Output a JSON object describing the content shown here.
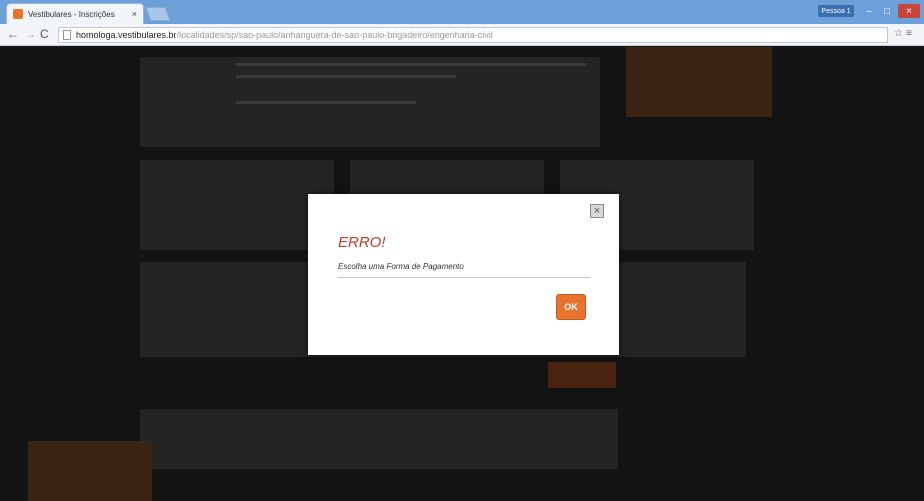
{
  "browser": {
    "tab_title": "Vestibulares - Inscrições",
    "tab_close": "×",
    "user_badge": "Pessoa 1",
    "win_min": "–",
    "win_max": "□",
    "win_close": "×",
    "url_host": "homologa.vestibulares.br",
    "url_path": "/localidades/sp/sao-paulo/anhanguera-de-sao-paulo-brigadeiro/engenharia-civil"
  },
  "dialog": {
    "title": "ERRO!",
    "message": "Escolha uma Forma de Pagamento",
    "ok_label": "OK",
    "close_label": "×"
  }
}
